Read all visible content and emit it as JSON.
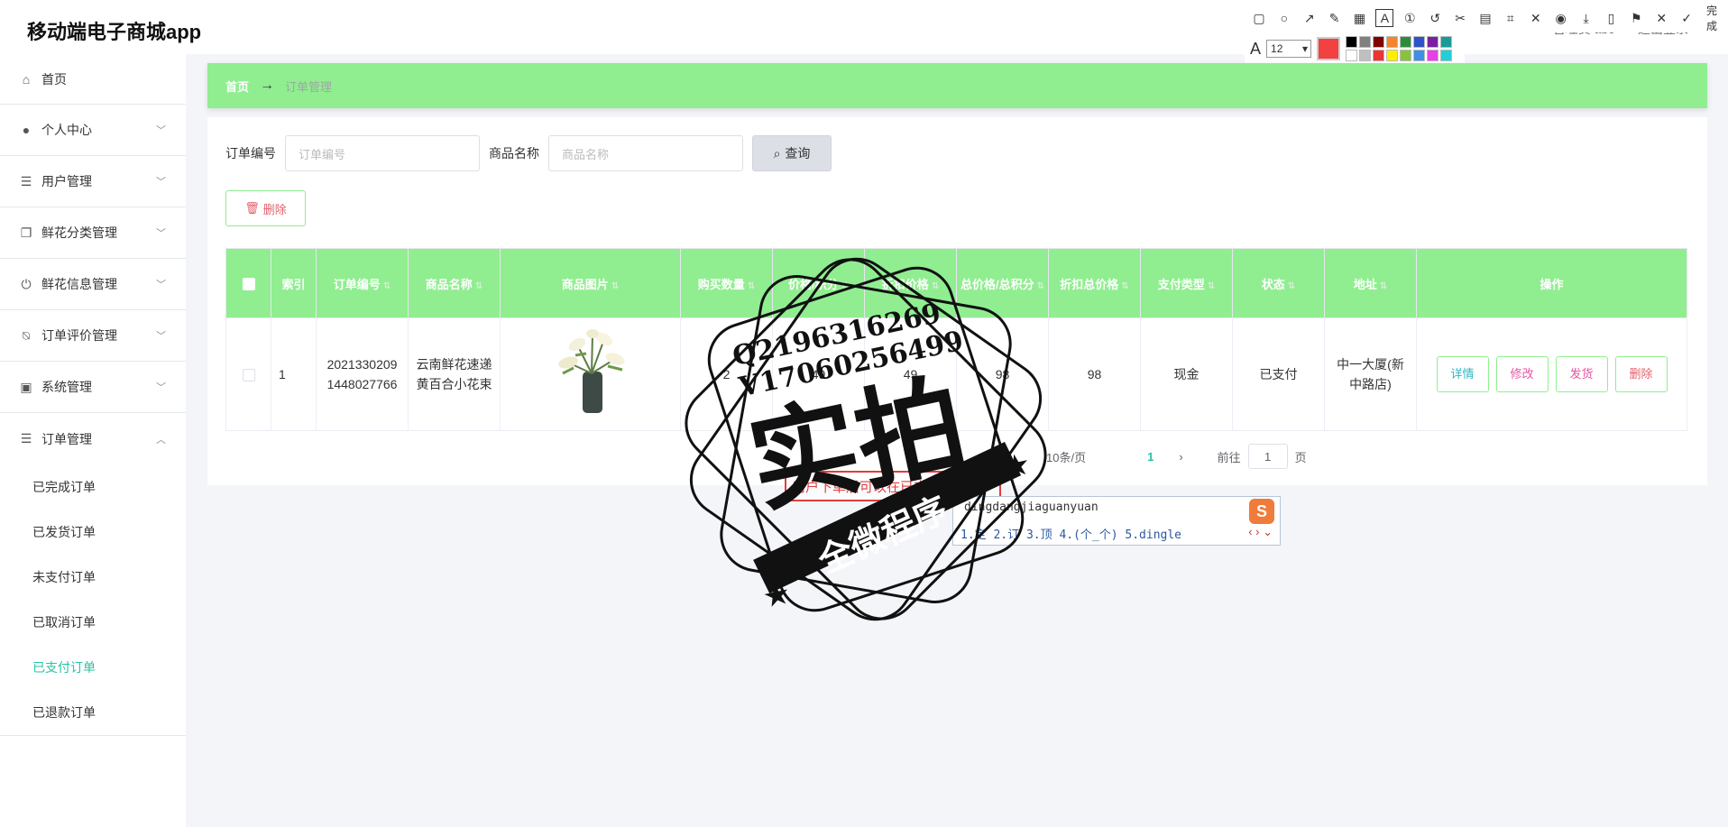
{
  "app": {
    "title": "移动端电子商城app"
  },
  "header": {
    "user_text": "管理员 abc",
    "logout": "退出登录"
  },
  "screenshot_tool": {
    "font_size": "12",
    "done_label": "完成",
    "active_color": "#f34040",
    "palette": [
      "#000000",
      "#808080",
      "#800000",
      "#f5842b",
      "#2e8b3d",
      "#2f51c9",
      "#7a1fa2",
      "#1a9a9a",
      "#ffffff",
      "#c0c0c0",
      "#ee3333",
      "#ffee00",
      "#88c43a",
      "#3f8fe6",
      "#e83fe6",
      "#1fd0d8"
    ]
  },
  "sidebar": {
    "items": [
      {
        "label": "首页",
        "icon": "home-icon"
      },
      {
        "label": "个人中心",
        "icon": "user-icon"
      },
      {
        "label": "用户管理",
        "icon": "sliders-icon"
      },
      {
        "label": "鲜花分类管理",
        "icon": "copy-icon"
      },
      {
        "label": "鲜花信息管理",
        "icon": "power-icon"
      },
      {
        "label": "订单评价管理",
        "icon": "bell-off-icon"
      },
      {
        "label": "系统管理",
        "icon": "calendar-x-icon"
      },
      {
        "label": "订单管理",
        "icon": "list-icon"
      }
    ],
    "order_sub": [
      "已完成订单",
      "已发货订单",
      "未支付订单",
      "已取消订单",
      "已支付订单",
      "已退款订单"
    ],
    "active_sub": "已支付订单"
  },
  "breadcrumb": {
    "home": "首页",
    "arrow": "→",
    "current": "订单管理"
  },
  "search": {
    "order_no_label": "订单编号",
    "order_no_placeholder": "订单编号",
    "product_label": "商品名称",
    "product_placeholder": "商品名称",
    "query_label": "查询"
  },
  "toolbar": {
    "delete_label": "删除"
  },
  "table": {
    "headers": [
      "索引",
      "订单编号",
      "商品名称",
      "商品图片",
      "购买数量",
      "价格/积分",
      "折扣价格",
      "总价格/总积分",
      "折扣总价格",
      "支付类型",
      "状态",
      "地址",
      "操作"
    ],
    "rows": [
      {
        "index": "1",
        "order_no": "20213302091448027766",
        "product": "云南鲜花速递黄百合小花束",
        "qty": "2",
        "price": "49",
        "discount_price": "49",
        "total": "98",
        "discount_total": "98",
        "pay_type": "现金",
        "status": "已支付",
        "address": "中一大厦(新中路店)"
      }
    ],
    "actions": {
      "detail": "详情",
      "edit": "修改",
      "ship": "发货",
      "delete": "删除"
    }
  },
  "pager": {
    "page_size": "10条/页",
    "current": "1",
    "goto": "前往",
    "page_input": "1",
    "page_unit": "页"
  },
  "ime": {
    "input": "dingdangjiaguanyuan",
    "candidates": "1.定 2.订 3.顶 4.(个_个) 5.dingle",
    "nav": "‹ › ⌄"
  },
  "hint": {
    "text": "用户下单后可以在已支付"
  },
  "watermark": {
    "qq": "Q2196316269",
    "wechat": "V17060256499",
    "big": "实拍",
    "banner": "全微程序"
  }
}
